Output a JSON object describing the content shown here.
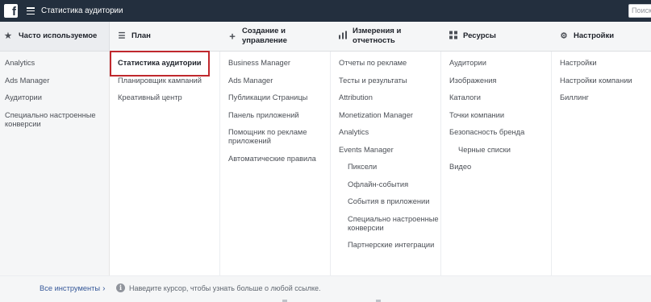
{
  "topbar": {
    "logo": "f",
    "title": "Статистика аудитории",
    "search_placeholder": "Поиск"
  },
  "frequent": {
    "header": "Часто используемое",
    "items": [
      "Analytics",
      "Ads Manager",
      "Аудитории",
      "Специально настроенные конверсии"
    ]
  },
  "columns": [
    {
      "header": "План",
      "icon": "list-icon",
      "items": [
        {
          "label": "Статистика аудитории",
          "sub": false
        },
        {
          "label": "Планировщик кампаний",
          "sub": false
        },
        {
          "label": "Креативный центр",
          "sub": false
        }
      ]
    },
    {
      "header": "Создание и управление",
      "icon": "plus-icon",
      "items": [
        {
          "label": "Business Manager",
          "sub": false
        },
        {
          "label": "Ads Manager",
          "sub": false
        },
        {
          "label": "Публикации Страницы",
          "sub": false
        },
        {
          "label": "Панель приложений",
          "sub": false
        },
        {
          "label": "Помощник по рекламе приложений",
          "sub": false
        },
        {
          "label": "Автоматические правила",
          "sub": false
        }
      ]
    },
    {
      "header": "Измерения и отчетность",
      "icon": "bar-chart-icon",
      "items": [
        {
          "label": "Отчеты по рекламе",
          "sub": false
        },
        {
          "label": "Тесты и результаты",
          "sub": false
        },
        {
          "label": "Attribution",
          "sub": false
        },
        {
          "label": "Monetization Manager",
          "sub": false
        },
        {
          "label": "Analytics",
          "sub": false
        },
        {
          "label": "Events Manager",
          "sub": false
        },
        {
          "label": "Пиксели",
          "sub": true
        },
        {
          "label": "Офлайн-события",
          "sub": true
        },
        {
          "label": "События в приложении",
          "sub": true
        },
        {
          "label": "Специально настроенные конверсии",
          "sub": true
        },
        {
          "label": "Партнерские интеграции",
          "sub": true
        }
      ]
    },
    {
      "header": "Ресурсы",
      "icon": "grid-icon",
      "items": [
        {
          "label": "Аудитории",
          "sub": false
        },
        {
          "label": "Изображения",
          "sub": false
        },
        {
          "label": "Каталоги",
          "sub": false
        },
        {
          "label": "Точки компании",
          "sub": false
        },
        {
          "label": "Безопасность бренда",
          "sub": false
        },
        {
          "label": "Черные списки",
          "sub": true
        },
        {
          "label": "Видео",
          "sub": false
        }
      ]
    },
    {
      "header": "Настройки",
      "icon": "gear-icon",
      "items": [
        {
          "label": "Настройки",
          "sub": false
        },
        {
          "label": "Настройки компании",
          "sub": false
        },
        {
          "label": "Биллинг",
          "sub": false
        }
      ]
    }
  ],
  "footer": {
    "all_tools": "Все инструменты",
    "hint": "Наведите курсор, чтобы узнать больше о любой ссылке."
  },
  "colors": {
    "topbar": "#232f3e",
    "highlight": "#c0282d",
    "link_blue": "#365899"
  }
}
